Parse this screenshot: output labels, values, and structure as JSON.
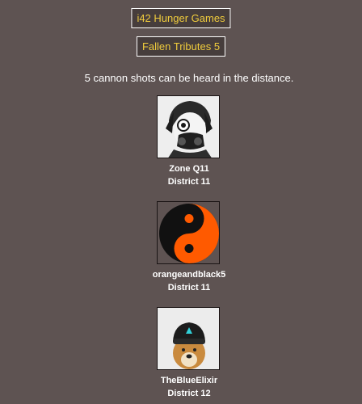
{
  "header": {
    "game_title": "i42 Hunger Games",
    "section_title": "Fallen Tributes 5"
  },
  "announcement": "5 cannon shots can be heard in the distance.",
  "tributes": [
    {
      "name": "Zone Q11",
      "district": "District 11",
      "avatar": "masked-anime-avatar"
    },
    {
      "name": "orangeandblack5",
      "district": "District 11",
      "avatar": "orange-yin-yang-avatar"
    },
    {
      "name": "TheBlueElixir",
      "district": "District 12",
      "avatar": "dog-in-beanie-avatar"
    }
  ],
  "colors": {
    "background": "#5e5352",
    "title_text": "#f0cc3c",
    "title_box": "#463d3c",
    "yin_yang_orange": "#ff5a00"
  }
}
